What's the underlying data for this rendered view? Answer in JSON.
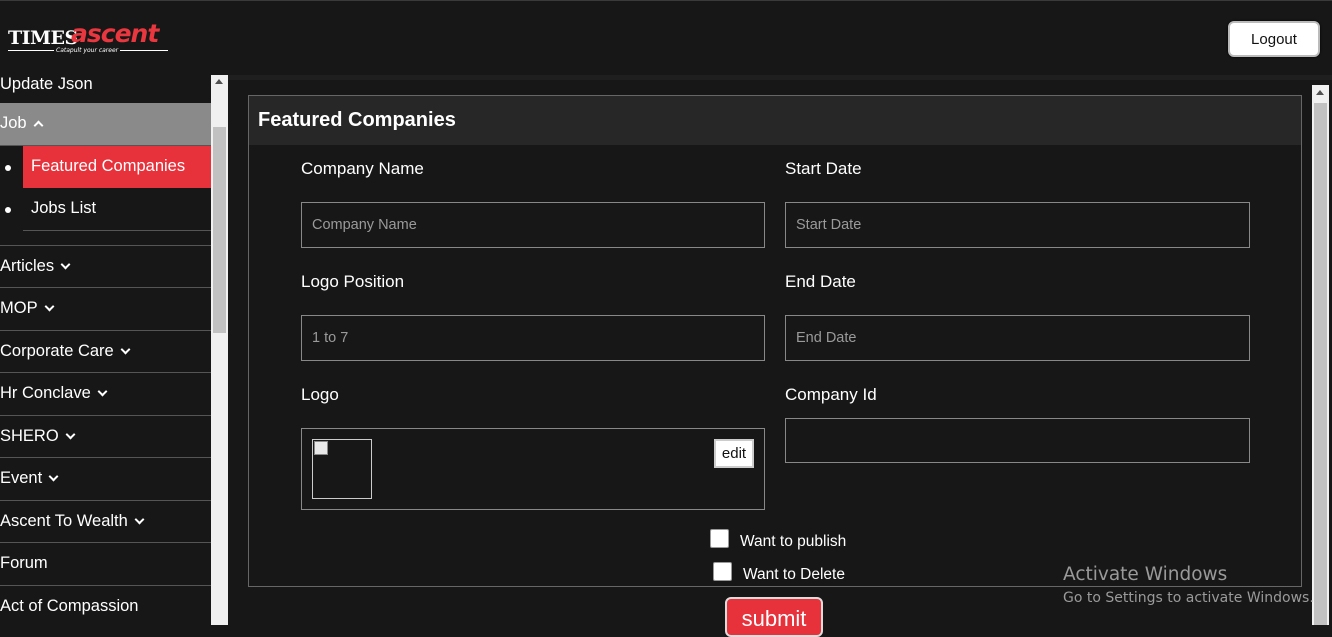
{
  "header": {
    "logo_times": "TIMES",
    "logo_ascent": "ascent",
    "logo_tagline": "Catapult your career",
    "logout_label": "Logout"
  },
  "sidebar": {
    "items": [
      {
        "label": "Update Json"
      },
      {
        "label": "Job"
      },
      {
        "label": "Articles"
      },
      {
        "label": "MOP"
      },
      {
        "label": "Corporate Care"
      },
      {
        "label": "Hr Conclave"
      },
      {
        "label": "SHERO"
      },
      {
        "label": "Event"
      },
      {
        "label": "Ascent To Wealth"
      },
      {
        "label": "Forum"
      },
      {
        "label": "Act of Compassion"
      }
    ],
    "job_subitems": [
      {
        "label": "Featured Companies"
      },
      {
        "label": "Jobs List"
      }
    ]
  },
  "form": {
    "title": "Featured Companies",
    "company_name": {
      "label": "Company Name",
      "placeholder": "Company Name",
      "value": ""
    },
    "start_date": {
      "label": "Start Date",
      "placeholder": "Start Date",
      "value": ""
    },
    "logo_position": {
      "label": "Logo Position",
      "placeholder": "1 to 7",
      "value": ""
    },
    "end_date": {
      "label": "End Date",
      "placeholder": "End Date",
      "value": ""
    },
    "logo": {
      "label": "Logo",
      "edit_label": "edit"
    },
    "company_id": {
      "label": "Company Id",
      "value": ""
    },
    "publish_label": "Want to publish",
    "delete_label": "Want to Delete",
    "submit_label": "submit"
  },
  "watermark": {
    "line1": "Activate Windows",
    "line2": "Go to Settings to activate Windows."
  },
  "colors": {
    "brand_red": "#e8323b",
    "background": "#171717",
    "active_nav": "#8a8a8a"
  }
}
